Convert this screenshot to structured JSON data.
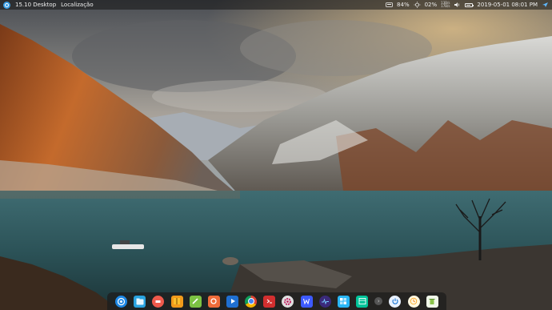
{
  "panel": {
    "launcher_label": "15.10 Desktop",
    "location_label": "Localização",
    "battery_percent": "84%",
    "battery_level": 0.84,
    "brightness_percent": "02%",
    "net_up": "13B/s",
    "net_down": "17B/s",
    "datetime": "2019-05-01 08:01 PM"
  },
  "dock": {
    "icons": [
      "launcher-icon",
      "file-manager-icon",
      "screenshot-icon",
      "archive-icon",
      "editor-icon",
      "settings-icon",
      "media-player-icon",
      "chrome-icon",
      "terminal-icon",
      "system-settings-icon",
      "writer-icon",
      "monitor-icon",
      "app-store-icon",
      "spreadsheet-icon",
      "more-icon",
      "power-icon",
      "clock-icon",
      "trash-icon"
    ]
  }
}
